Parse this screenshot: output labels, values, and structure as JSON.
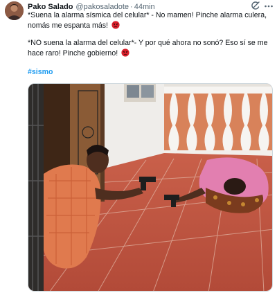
{
  "tweet": {
    "author_name": "Pako Salado",
    "author_handle": "@pakosaladote",
    "separator": "·",
    "time": "44min",
    "paragraph1_line1": "*Suena la alarma sísmica del celular* - No mamen! Pinche alarma culera,",
    "paragraph1_line2": "nomás me espanta más!",
    "paragraph2_line1": "*NO suena la alarma del celular*- Y por qué ahora no sonó? Eso sí se me",
    "paragraph2_line2": "hace raro! Pinche gobierno!",
    "hashtag": "#sismo",
    "emoji": "angry-face",
    "header_icons": [
      "grok-icon",
      "more-icon"
    ]
  },
  "colors": {
    "link": "#1d9bf0",
    "secondary_text": "#536471",
    "text": "#0f1419",
    "emoji_red": "#d9202c"
  }
}
